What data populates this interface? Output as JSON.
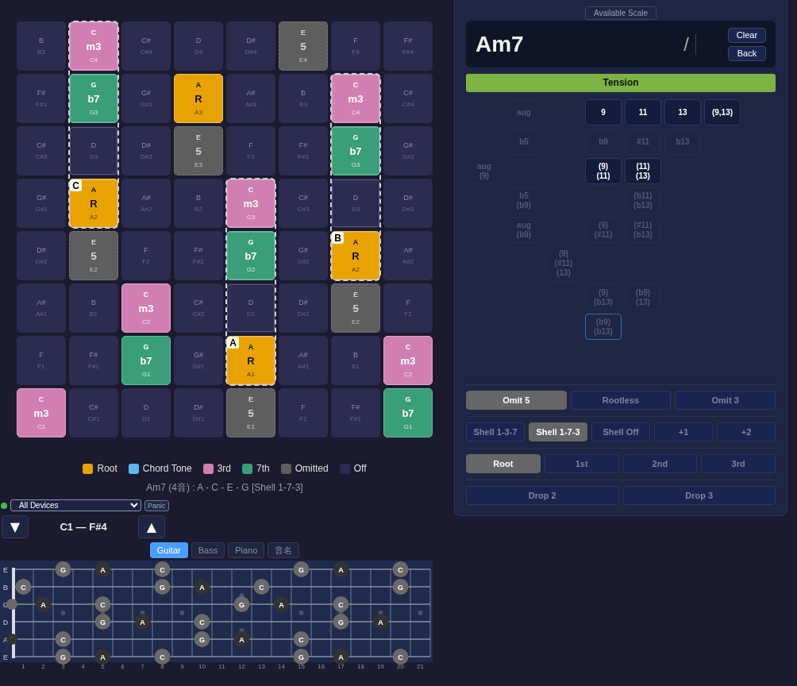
{
  "pad_grid": {
    "rows": [
      [
        {
          "note": "B",
          "octave": "B3",
          "kind": "off",
          "in_voicing": false
        },
        {
          "note": "C",
          "degree": "m3",
          "octave": "C4",
          "kind": "third",
          "in_voicing": true
        },
        {
          "note": "C#",
          "octave": "C#4",
          "kind": "off",
          "in_voicing": false
        },
        {
          "note": "D",
          "octave": "D4",
          "kind": "off",
          "in_voicing": false
        },
        {
          "note": "D#",
          "octave": "D#4",
          "kind": "off",
          "in_voicing": false
        },
        {
          "note": "E",
          "degree": "5",
          "octave": "E4",
          "kind": "omitted",
          "in_voicing": false
        },
        {
          "note": "F",
          "octave": "F4",
          "kind": "off",
          "in_voicing": false
        },
        {
          "note": "F#",
          "octave": "F#4",
          "kind": "off",
          "in_voicing": false
        }
      ],
      [
        {
          "note": "F#",
          "octave": "F#3",
          "kind": "off",
          "in_voicing": false
        },
        {
          "note": "G",
          "degree": "b7",
          "octave": "G3",
          "kind": "seventh",
          "in_voicing": true
        },
        {
          "note": "G#",
          "octave": "G#3",
          "kind": "off",
          "in_voicing": false
        },
        {
          "note": "A",
          "degree": "R",
          "octave": "A3",
          "kind": "root",
          "in_voicing": false
        },
        {
          "note": "A#",
          "octave": "A#3",
          "kind": "off",
          "in_voicing": false
        },
        {
          "note": "B",
          "octave": "B3",
          "kind": "off",
          "in_voicing": false
        },
        {
          "note": "C",
          "degree": "m3",
          "octave": "C4",
          "kind": "third",
          "in_voicing": true
        },
        {
          "note": "C#",
          "octave": "C#4",
          "kind": "off",
          "in_voicing": false
        }
      ],
      [
        {
          "note": "C#",
          "octave": "C#3",
          "kind": "off",
          "in_voicing": false
        },
        {
          "note": "D",
          "octave": "D3",
          "kind": "off",
          "in_voicing": true
        },
        {
          "note": "D#",
          "octave": "D#3",
          "kind": "off",
          "in_voicing": false
        },
        {
          "note": "E",
          "degree": "5",
          "octave": "E3",
          "kind": "omitted",
          "in_voicing": false
        },
        {
          "note": "F",
          "octave": "F3",
          "kind": "off",
          "in_voicing": false
        },
        {
          "note": "F#",
          "octave": "F#3",
          "kind": "off",
          "in_voicing": false
        },
        {
          "note": "G",
          "degree": "b7",
          "octave": "G3",
          "kind": "seventh",
          "in_voicing": true
        },
        {
          "note": "G#",
          "octave": "G#3",
          "kind": "off",
          "in_voicing": false
        }
      ],
      [
        {
          "note": "G#",
          "octave": "G#2",
          "kind": "off",
          "in_voicing": false
        },
        {
          "note": "A",
          "degree": "R",
          "octave": "A2",
          "kind": "root",
          "in_voicing": true,
          "badge": "C"
        },
        {
          "note": "A#",
          "octave": "A#2",
          "kind": "off",
          "in_voicing": false
        },
        {
          "note": "B",
          "octave": "B2",
          "kind": "off",
          "in_voicing": false
        },
        {
          "note": "C",
          "degree": "m3",
          "octave": "C3",
          "kind": "third",
          "in_voicing": true
        },
        {
          "note": "C#",
          "octave": "C#3",
          "kind": "off",
          "in_voicing": false
        },
        {
          "note": "D",
          "octave": "D3",
          "kind": "off",
          "in_voicing": true
        },
        {
          "note": "D#",
          "octave": "D#3",
          "kind": "off",
          "in_voicing": false
        }
      ],
      [
        {
          "note": "D#",
          "octave": "D#2",
          "kind": "off",
          "in_voicing": false
        },
        {
          "note": "E",
          "degree": "5",
          "octave": "E2",
          "kind": "omitted",
          "in_voicing": false
        },
        {
          "note": "F",
          "octave": "F2",
          "kind": "off",
          "in_voicing": false
        },
        {
          "note": "F#",
          "octave": "F#2",
          "kind": "off",
          "in_voicing": false
        },
        {
          "note": "G",
          "degree": "b7",
          "octave": "G2",
          "kind": "seventh",
          "in_voicing": true
        },
        {
          "note": "G#",
          "octave": "G#2",
          "kind": "off",
          "in_voicing": false
        },
        {
          "note": "A",
          "degree": "R",
          "octave": "A2",
          "kind": "root",
          "in_voicing": true,
          "badge": "B"
        },
        {
          "note": "A#",
          "octave": "A#2",
          "kind": "off",
          "in_voicing": false
        }
      ],
      [
        {
          "note": "A#",
          "octave": "A#1",
          "kind": "off",
          "in_voicing": false
        },
        {
          "note": "B",
          "octave": "B1",
          "kind": "off",
          "in_voicing": false
        },
        {
          "note": "C",
          "degree": "m3",
          "octave": "C2",
          "kind": "third",
          "in_voicing": false
        },
        {
          "note": "C#",
          "octave": "C#2",
          "kind": "off",
          "in_voicing": false
        },
        {
          "note": "D",
          "octave": "D2",
          "kind": "off",
          "in_voicing": true
        },
        {
          "note": "D#",
          "octave": "D#2",
          "kind": "off",
          "in_voicing": false
        },
        {
          "note": "E",
          "degree": "5",
          "octave": "E2",
          "kind": "omitted",
          "in_voicing": false
        },
        {
          "note": "F",
          "octave": "F2",
          "kind": "off",
          "in_voicing": false
        }
      ],
      [
        {
          "note": "F",
          "octave": "F1",
          "kind": "off",
          "in_voicing": false
        },
        {
          "note": "F#",
          "octave": "F#1",
          "kind": "off",
          "in_voicing": false
        },
        {
          "note": "G",
          "degree": "b7",
          "octave": "G1",
          "kind": "seventh",
          "in_voicing": false
        },
        {
          "note": "G#",
          "octave": "G#1",
          "kind": "off",
          "in_voicing": false
        },
        {
          "note": "A",
          "degree": "R",
          "octave": "A1",
          "kind": "root",
          "in_voicing": true,
          "badge": "A"
        },
        {
          "note": "A#",
          "octave": "A#1",
          "kind": "off",
          "in_voicing": false
        },
        {
          "note": "B",
          "octave": "B1",
          "kind": "off",
          "in_voicing": false
        },
        {
          "note": "C",
          "degree": "m3",
          "octave": "C2",
          "kind": "third",
          "in_voicing": false
        }
      ],
      [
        {
          "note": "C",
          "degree": "m3",
          "octave": "C1",
          "kind": "third",
          "in_voicing": false
        },
        {
          "note": "C#",
          "octave": "C#1",
          "kind": "off",
          "in_voicing": false
        },
        {
          "note": "D",
          "octave": "D1",
          "kind": "off",
          "in_voicing": false
        },
        {
          "note": "D#",
          "octave": "D#1",
          "kind": "off",
          "in_voicing": false
        },
        {
          "note": "E",
          "degree": "5",
          "octave": "E1",
          "kind": "omitted",
          "in_voicing": false
        },
        {
          "note": "F",
          "octave": "F1",
          "kind": "off",
          "in_voicing": false
        },
        {
          "note": "F#",
          "octave": "F#1",
          "kind": "off",
          "in_voicing": false
        },
        {
          "note": "G",
          "degree": "b7",
          "octave": "G1",
          "kind": "seventh",
          "in_voicing": false
        }
      ]
    ]
  },
  "legend": [
    {
      "label": "Root",
      "color": "#e8a202"
    },
    {
      "label": "Chord Tone",
      "color": "#5ab8f0"
    },
    {
      "label": "3rd",
      "color": "#d17fb2"
    },
    {
      "label": "7th",
      "color": "#3a9e78"
    },
    {
      "label": "Omitted",
      "color": "#5e5e5e"
    },
    {
      "label": "Off",
      "color": "#2c2b50"
    }
  ],
  "chord_summary": "Am7 (4音) : A - C - E - G [Shell 1-7-3]",
  "midi": {
    "connected": true,
    "device": "All Devices",
    "panic_label": "Panic"
  },
  "octave_range": {
    "down": "▼",
    "range": "C1 — F#4",
    "up": "▲"
  },
  "view_tabs": [
    {
      "label": "Guitar",
      "selected": true
    },
    {
      "label": "Bass",
      "selected": false
    },
    {
      "label": "Piano",
      "selected": false
    },
    {
      "label": "音名",
      "selected": false
    }
  ],
  "fretboard": {
    "fret_numbers": [
      "1",
      "2",
      "3",
      "4",
      "5",
      "6",
      "7",
      "8",
      "9",
      "10",
      "11",
      "12",
      "13",
      "14",
      "15",
      "16",
      "17",
      "18",
      "19",
      "20",
      "21"
    ],
    "strings": [
      {
        "label": "E",
        "frets": [
          {
            "kind": "none"
          },
          {
            "kind": "none"
          },
          {
            "kind": "none"
          },
          {
            "kind": "tone",
            "note": "G"
          },
          {
            "kind": "none"
          },
          {
            "kind": "root",
            "note": "A"
          },
          {
            "kind": "none"
          },
          {
            "kind": "none"
          },
          {
            "kind": "tone",
            "note": "C"
          },
          {
            "kind": "none"
          },
          {
            "kind": "none"
          },
          {
            "kind": "none"
          },
          {
            "kind": "none"
          },
          {
            "kind": "none"
          },
          {
            "kind": "none"
          },
          {
            "kind": "tone",
            "note": "G"
          },
          {
            "kind": "none"
          },
          {
            "kind": "root",
            "note": "A"
          },
          {
            "kind": "none"
          },
          {
            "kind": "none"
          },
          {
            "kind": "tone",
            "note": "C"
          },
          {
            "kind": "none"
          }
        ]
      },
      {
        "label": "B",
        "frets": [
          {
            "kind": "none"
          },
          {
            "kind": "tone",
            "note": "C"
          },
          {
            "kind": "none"
          },
          {
            "kind": "none"
          },
          {
            "kind": "none"
          },
          {
            "kind": "none"
          },
          {
            "kind": "none"
          },
          {
            "kind": "none"
          },
          {
            "kind": "tone",
            "note": "G"
          },
          {
            "kind": "none"
          },
          {
            "kind": "root",
            "note": "A"
          },
          {
            "kind": "none"
          },
          {
            "kind": "none"
          },
          {
            "kind": "tone",
            "note": "C"
          },
          {
            "kind": "none"
          },
          {
            "kind": "none"
          },
          {
            "kind": "none"
          },
          {
            "kind": "none"
          },
          {
            "kind": "none"
          },
          {
            "kind": "none"
          },
          {
            "kind": "tone",
            "note": "G"
          },
          {
            "kind": "none"
          }
        ]
      },
      {
        "label": "G",
        "frets": [
          {
            "kind": "tone"
          },
          {
            "kind": "none"
          },
          {
            "kind": "root",
            "note": "A"
          },
          {
            "kind": "none"
          },
          {
            "kind": "none"
          },
          {
            "kind": "tone",
            "note": "C"
          },
          {
            "kind": "none"
          },
          {
            "kind": "none"
          },
          {
            "kind": "none"
          },
          {
            "kind": "none"
          },
          {
            "kind": "none"
          },
          {
            "kind": "none"
          },
          {
            "kind": "tone",
            "note": "G"
          },
          {
            "kind": "none"
          },
          {
            "kind": "root",
            "note": "A"
          },
          {
            "kind": "none"
          },
          {
            "kind": "none"
          },
          {
            "kind": "tone",
            "note": "C"
          },
          {
            "kind": "none"
          },
          {
            "kind": "none"
          },
          {
            "kind": "none"
          },
          {
            "kind": "none"
          }
        ]
      },
      {
        "label": "D",
        "frets": [
          {
            "kind": "none"
          },
          {
            "kind": "none"
          },
          {
            "kind": "none"
          },
          {
            "kind": "none"
          },
          {
            "kind": "none"
          },
          {
            "kind": "tone",
            "note": "G"
          },
          {
            "kind": "none"
          },
          {
            "kind": "root",
            "note": "A"
          },
          {
            "kind": "none"
          },
          {
            "kind": "none"
          },
          {
            "kind": "tone",
            "note": "C"
          },
          {
            "kind": "none"
          },
          {
            "kind": "none"
          },
          {
            "kind": "none"
          },
          {
            "kind": "none"
          },
          {
            "kind": "none"
          },
          {
            "kind": "none"
          },
          {
            "kind": "tone",
            "note": "G"
          },
          {
            "kind": "none"
          },
          {
            "kind": "root",
            "note": "A"
          },
          {
            "kind": "none"
          },
          {
            "kind": "none"
          }
        ]
      },
      {
        "label": "A",
        "frets": [
          {
            "kind": "root"
          },
          {
            "kind": "none"
          },
          {
            "kind": "none"
          },
          {
            "kind": "tone",
            "note": "C"
          },
          {
            "kind": "none"
          },
          {
            "kind": "none"
          },
          {
            "kind": "none"
          },
          {
            "kind": "none"
          },
          {
            "kind": "none"
          },
          {
            "kind": "none"
          },
          {
            "kind": "tone",
            "note": "G"
          },
          {
            "kind": "none"
          },
          {
            "kind": "root",
            "note": "A"
          },
          {
            "kind": "none"
          },
          {
            "kind": "none"
          },
          {
            "kind": "tone",
            "note": "C"
          },
          {
            "kind": "none"
          },
          {
            "kind": "none"
          },
          {
            "kind": "none"
          },
          {
            "kind": "none"
          },
          {
            "kind": "none"
          },
          {
            "kind": "none"
          }
        ]
      },
      {
        "label": "E",
        "frets": [
          {
            "kind": "none"
          },
          {
            "kind": "none"
          },
          {
            "kind": "none"
          },
          {
            "kind": "tone",
            "note": "G"
          },
          {
            "kind": "none"
          },
          {
            "kind": "root",
            "note": "A"
          },
          {
            "kind": "none"
          },
          {
            "kind": "none"
          },
          {
            "kind": "tone",
            "note": "C"
          },
          {
            "kind": "none"
          },
          {
            "kind": "none"
          },
          {
            "kind": "none"
          },
          {
            "kind": "none"
          },
          {
            "kind": "none"
          },
          {
            "kind": "none"
          },
          {
            "kind": "tone",
            "note": "G"
          },
          {
            "kind": "none"
          },
          {
            "kind": "root",
            "note": "A"
          },
          {
            "kind": "none"
          },
          {
            "kind": "none"
          },
          {
            "kind": "tone",
            "note": "C"
          },
          {
            "kind": "none"
          }
        ]
      }
    ]
  },
  "panel": {
    "scale_button": "Available Scale",
    "chord": "Am7",
    "slash": "/",
    "clear": "Clear",
    "back": "Back",
    "tension_header": "Tension",
    "tension_rows": [
      [
        {
          "kind": "empty"
        },
        {
          "kind": "cell",
          "label": "aug",
          "available": false,
          "focused": false
        },
        {
          "kind": "empty"
        },
        {
          "kind": "cell",
          "label": "9",
          "available": true,
          "focused": false
        },
        {
          "kind": "cell",
          "label": "11",
          "available": true,
          "focused": false
        },
        {
          "kind": "cell",
          "label": "13",
          "available": true,
          "focused": false
        },
        {
          "kind": "cell",
          "label": "(9,13)",
          "available": true,
          "focused": false
        }
      ],
      [
        {
          "kind": "empty"
        },
        {
          "kind": "cell",
          "label": "b5",
          "available": false,
          "focused": false
        },
        {
          "kind": "empty"
        },
        {
          "kind": "cell",
          "label": "b9",
          "available": false,
          "focused": false
        },
        {
          "kind": "cell",
          "label": "#11",
          "available": false,
          "focused": false
        },
        {
          "kind": "cell",
          "label": "b13",
          "available": false,
          "focused": false
        }
      ],
      [
        {
          "kind": "cell",
          "label": "aug\n(9)",
          "available": false,
          "focused": false
        },
        {
          "kind": "empty"
        },
        {
          "kind": "empty"
        },
        {
          "kind": "cell",
          "label": "(9)\n(11)",
          "available": true,
          "focused": false
        },
        {
          "kind": "cell",
          "label": "(11)\n(13)",
          "available": true,
          "focused": false
        }
      ],
      [
        {
          "kind": "empty"
        },
        {
          "kind": "cell",
          "label": "b5\n(b9)",
          "available": false,
          "focused": false
        },
        {
          "kind": "empty"
        },
        {
          "kind": "empty"
        },
        {
          "kind": "cell",
          "label": "(b11)\n(b13)",
          "available": false,
          "focused": false
        }
      ],
      [
        {
          "kind": "empty"
        },
        {
          "kind": "cell",
          "label": "aug\n(b9)",
          "available": false,
          "focused": false
        },
        {
          "kind": "empty"
        },
        {
          "kind": "cell",
          "label": "(9)\n(#11)",
          "available": false,
          "focused": false
        },
        {
          "kind": "cell",
          "label": "(#11)\n(b13)",
          "available": false,
          "focused": false
        }
      ],
      [
        {
          "kind": "empty"
        },
        {
          "kind": "empty"
        },
        {
          "kind": "cell",
          "label": "(9)\n(#11)\n(13)",
          "available": false,
          "focused": false
        }
      ],
      [
        {
          "kind": "empty"
        },
        {
          "kind": "empty"
        },
        {
          "kind": "empty"
        },
        {
          "kind": "cell",
          "label": "(9)\n(b13)",
          "available": false,
          "focused": false
        },
        {
          "kind": "cell",
          "label": "(b9)\n(13)",
          "available": false,
          "focused": false
        }
      ],
      [
        {
          "kind": "empty"
        },
        {
          "kind": "empty"
        },
        {
          "kind": "empty"
        },
        {
          "kind": "cell",
          "label": "(b9)\n(b13)",
          "available": false,
          "focused": true
        }
      ]
    ],
    "option_rows": [
      [
        {
          "label": "Omit 5",
          "selected": true
        },
        {
          "label": "Rootless",
          "selected": false
        },
        {
          "label": "Omit 3",
          "selected": false
        }
      ],
      [
        {
          "label": "Shell 1-3-7",
          "selected": false
        },
        {
          "label": "Shell 1-7-3",
          "selected": true
        },
        {
          "label": "Shell Off",
          "selected": false
        },
        {
          "label": "+1",
          "selected": false
        },
        {
          "label": "+2",
          "selected": false
        }
      ],
      [
        {
          "label": "Root",
          "selected": true
        },
        {
          "label": "1st",
          "selected": false
        },
        {
          "label": "2nd",
          "selected": false
        },
        {
          "label": "3rd",
          "selected": false
        }
      ],
      [
        {
          "label": "Drop 2",
          "selected": false
        },
        {
          "label": "Drop 3",
          "selected": false
        }
      ]
    ]
  }
}
